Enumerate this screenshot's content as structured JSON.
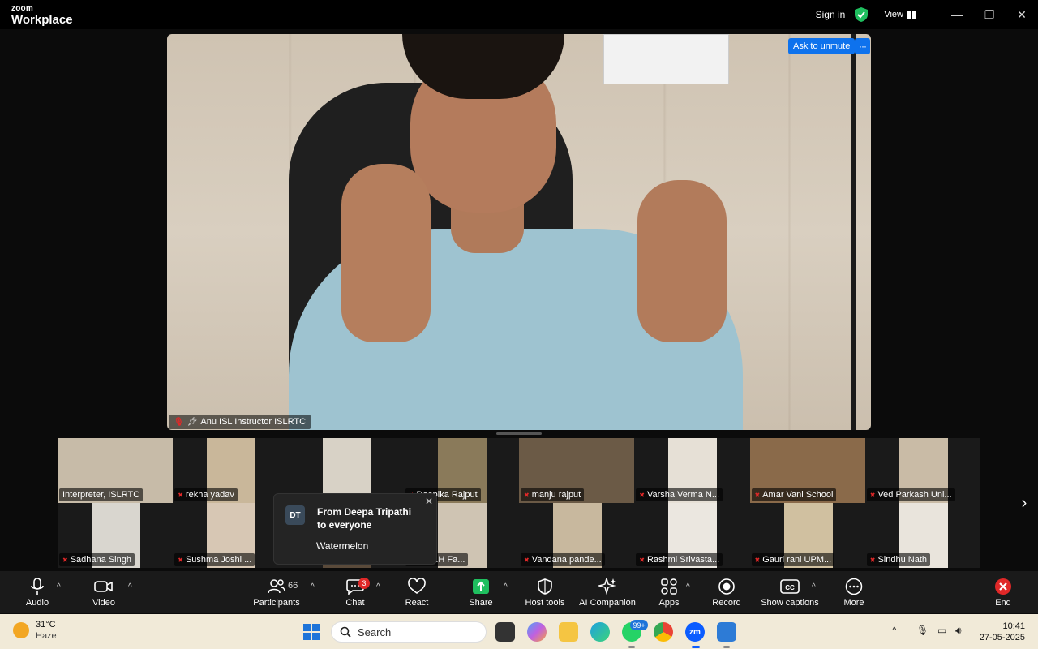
{
  "titlebar": {
    "logo_top": "zoom",
    "logo_bottom": "Workplace",
    "sign_in": "Sign in",
    "view": "View"
  },
  "main_video": {
    "participant_name": "Anu ISL Instructor ISLRTC",
    "ask_to_unmute": "Ask to unmute"
  },
  "gallery": {
    "tiles": [
      {
        "name": "Interpreter, ISLRTC",
        "muted": false
      },
      {
        "name": "rekha yadav",
        "muted": true
      },
      {
        "name": "",
        "muted": true
      },
      {
        "name": "Deepika Rajput",
        "muted": true
      },
      {
        "name": "manju rajput",
        "muted": true
      },
      {
        "name": "Varsha Verma N...",
        "muted": true
      },
      {
        "name": "Amar Vani School",
        "muted": true
      },
      {
        "name": "Ved Parkash Uni...",
        "muted": true
      },
      {
        "name": "Sadhana Singh",
        "muted": true
      },
      {
        "name": "Sushma Joshi ...",
        "muted": true
      },
      {
        "name": "",
        "muted": false
      },
      {
        "name": "ini A.W.H Fa...",
        "muted": false
      },
      {
        "name": "Vandana pande...",
        "muted": true
      },
      {
        "name": "Rashmi Srivasta...",
        "muted": true
      },
      {
        "name": "Gauri rani UPM...",
        "muted": true
      },
      {
        "name": "Sindhu Nath",
        "muted": true
      }
    ]
  },
  "chat_toast": {
    "avatar": "DT",
    "from": "From Deepa Tripathi to everyone",
    "message": "Watermelon"
  },
  "toolbar": {
    "audio": "Audio",
    "video": "Video",
    "participants": "Participants",
    "participants_count": "66",
    "chat": "Chat",
    "chat_badge": "3",
    "react": "React",
    "share": "Share",
    "host_tools": "Host tools",
    "ai_companion": "AI Companion",
    "apps": "Apps",
    "record": "Record",
    "show_captions": "Show captions",
    "more": "More",
    "end": "End"
  },
  "taskbar": {
    "temperature": "31°C",
    "weather": "Haze",
    "search_placeholder": "Search",
    "whatsapp_badge": "99+",
    "time": "10:41",
    "date": "27-05-2025"
  },
  "colors": {
    "accent": "#0e72ed",
    "end_red": "#e02828",
    "share_green": "#1fbf5f"
  }
}
